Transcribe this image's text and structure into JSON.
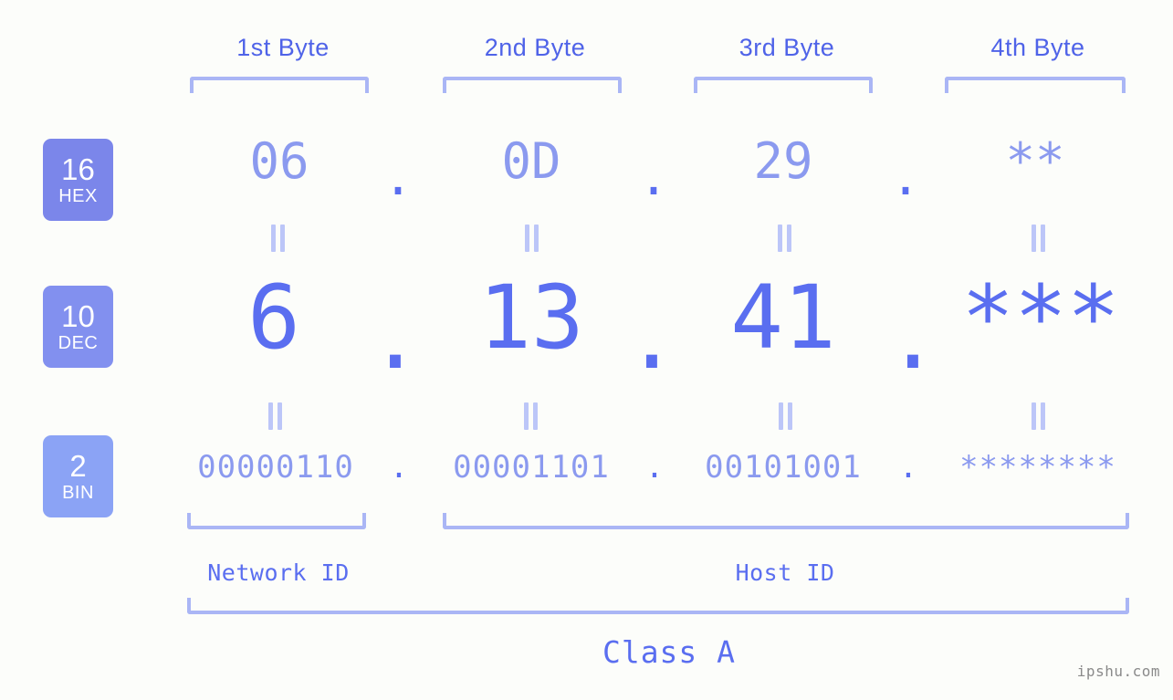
{
  "meta": {
    "watermark": "ipshu.com",
    "background": "#fcfdfa",
    "accent_strong": "#5a6ef0",
    "accent_soft": "#8b9aef",
    "accent_bracket": "#aab6f5",
    "header_color": "#4f63e8"
  },
  "headers": [
    {
      "label": "1st Byte"
    },
    {
      "label": "2nd Byte"
    },
    {
      "label": "3rd Byte"
    },
    {
      "label": "4th Byte"
    }
  ],
  "badges": [
    {
      "num": "16",
      "abbr": "HEX",
      "color": "#7b86ea"
    },
    {
      "num": "10",
      "abbr": "DEC",
      "color": "#8290ef"
    },
    {
      "num": "2",
      "abbr": "BIN",
      "color": "#8ba3f5"
    }
  ],
  "separator": ".",
  "rows": {
    "hex": {
      "name": "hex",
      "values": [
        "06",
        "0D",
        "29",
        "**"
      ]
    },
    "dec": {
      "name": "dec",
      "values": [
        "6",
        "13",
        "41",
        "***"
      ]
    },
    "bin": {
      "name": "bin",
      "values": [
        "00000110",
        "00001101",
        "00101001",
        "********"
      ]
    }
  },
  "footer": {
    "network_id": "Network ID",
    "host_id": "Host ID",
    "class": "Class A"
  }
}
